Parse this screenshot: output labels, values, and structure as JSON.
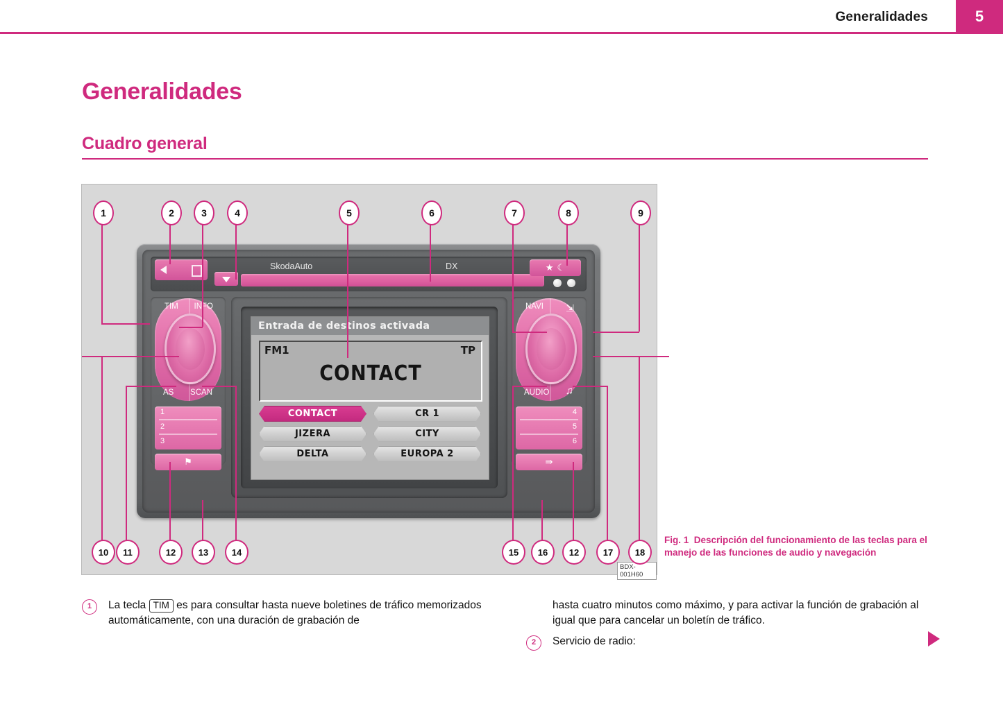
{
  "header": {
    "title": "Generalidades",
    "page_number": "5"
  },
  "headings": {
    "h1": "Generalidades",
    "h2": "Cuadro general"
  },
  "figure": {
    "caption_label": "Fig. 1",
    "caption_text": "Descripción del funcionamiento de las teclas para el manejo de las funciones de audio y navegación",
    "code": "BDX-001H60",
    "callouts_top": [
      "1",
      "2",
      "3",
      "4",
      "5",
      "6",
      "7",
      "8",
      "9"
    ],
    "callouts_bottom_left": [
      "10",
      "11",
      "12",
      "13",
      "14"
    ],
    "callouts_bottom_right": [
      "15",
      "16",
      "12",
      "17",
      "18"
    ]
  },
  "radio": {
    "top_strip": {
      "eject_icon": "eject-left-icon",
      "cd_icon": "cd-slot-icon",
      "down_button_icon": "triangle-down-icon",
      "brand_label": "SkodaAuto",
      "mode_label": "DX",
      "light_button_icons": "sun-moon-icon"
    },
    "left_pod": {
      "top_left_label": "TIM",
      "top_right_label": "INFO",
      "bottom_left_label": "AS",
      "bottom_right_label": "SCAN",
      "presets": [
        "1",
        "2",
        "3"
      ],
      "bottom_key_icon": "flag-icon"
    },
    "right_pod": {
      "top_left_label": "NAVI",
      "top_right_icon": "map-layers-icon",
      "bottom_left_label": "AUDIO",
      "bottom_right_icon": "music-note-icon",
      "presets": [
        "4",
        "5",
        "6"
      ],
      "bottom_key_icon": "cassette-eject-icon"
    },
    "screen": {
      "title": "Entrada de destinos activada",
      "band": "FM1",
      "tp": "TP",
      "station": "CONTACT",
      "station_list": [
        [
          "CONTACT",
          "CR 1"
        ],
        [
          "JIZERA",
          "CITY"
        ],
        [
          "DELTA",
          "EUROPA 2"
        ]
      ],
      "selected_station": "CONTACT"
    }
  },
  "body": {
    "left": [
      {
        "num": "1",
        "text_before": "La tecla",
        "keycap": "TIM",
        "text_after": "es para consultar hasta nueve boletines de tráfico memorizados automáticamente, con una duración de grabación de"
      }
    ],
    "right": [
      {
        "num": "",
        "text": "hasta cuatro minutos como máximo, y para activar la función de grabación al igual que para cancelar un boletín de tráfico."
      },
      {
        "num": "2",
        "text": "Servicio de radio:"
      }
    ]
  },
  "colors": {
    "accent": "#cf2a7e",
    "text": "#111111"
  }
}
